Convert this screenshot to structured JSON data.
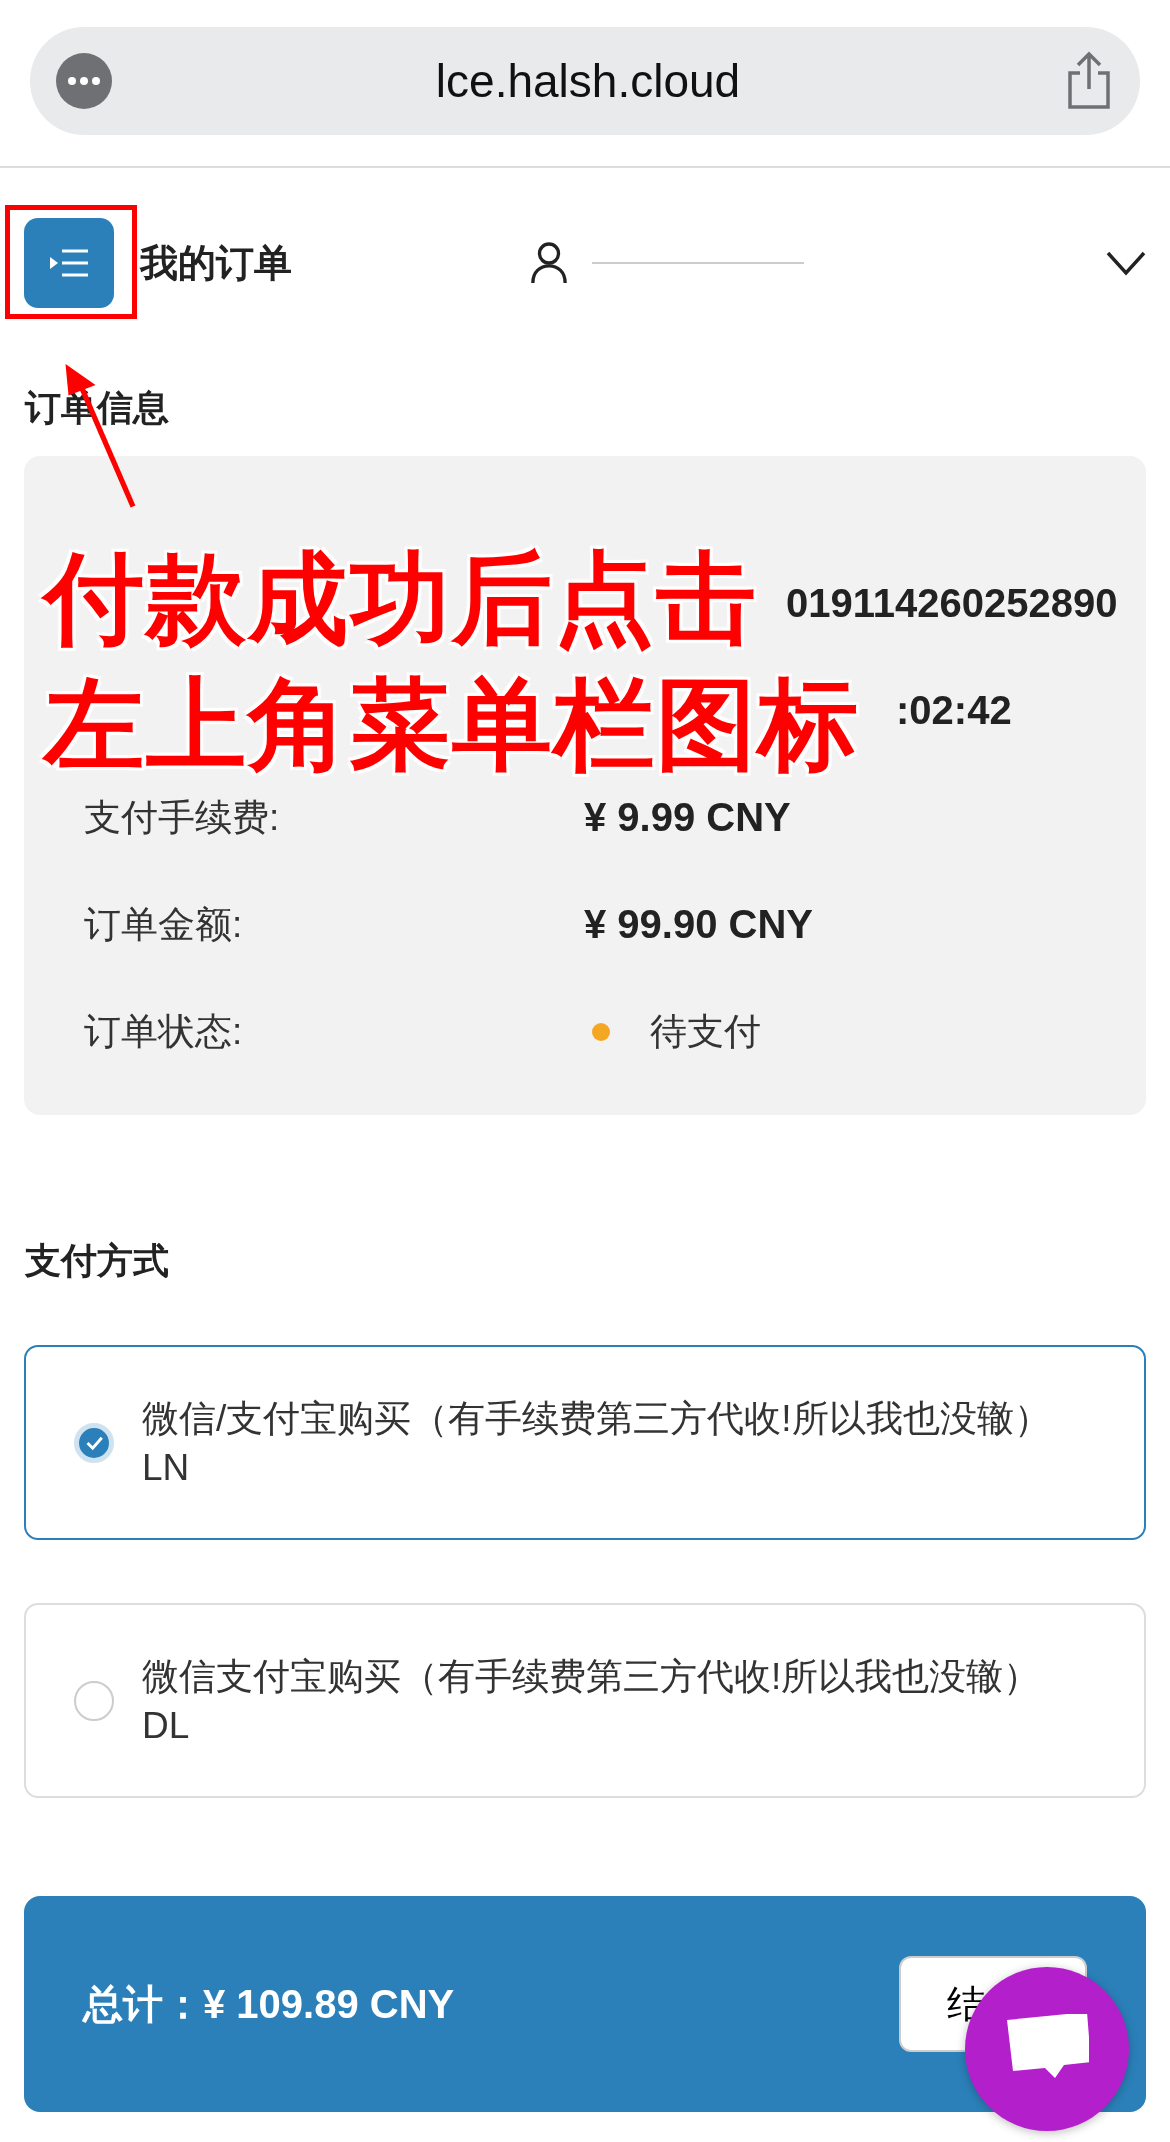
{
  "browser": {
    "url": "lce.halsh.cloud"
  },
  "header": {
    "title": "我的订单"
  },
  "order_info": {
    "title": "订单信息",
    "rows": [
      {
        "value": "019114260252890"
      },
      {
        "value": ":02:42"
      },
      {
        "label": "支付手续费:",
        "value": "¥ 9.99 CNY"
      },
      {
        "label": "订单金额:",
        "value": "¥ 99.90 CNY"
      },
      {
        "label": "订单状态:",
        "value": "待支付",
        "kind": "status",
        "color": "#f5a623"
      }
    ]
  },
  "payment": {
    "title": "支付方式",
    "options": [
      {
        "label": "微信/支付宝购买（有手续费第三方代收!所以我也没辙）LN",
        "selected": true
      },
      {
        "label": "微信支付宝购买（有手续费第三方代收!所以我也没辙）DL",
        "selected": false
      }
    ]
  },
  "total": {
    "label": "总计：¥ 109.89 CNY",
    "button": "结"
  },
  "annotation": {
    "lines": [
      "付款成功后点击",
      "左上角菜单栏图标"
    ]
  }
}
